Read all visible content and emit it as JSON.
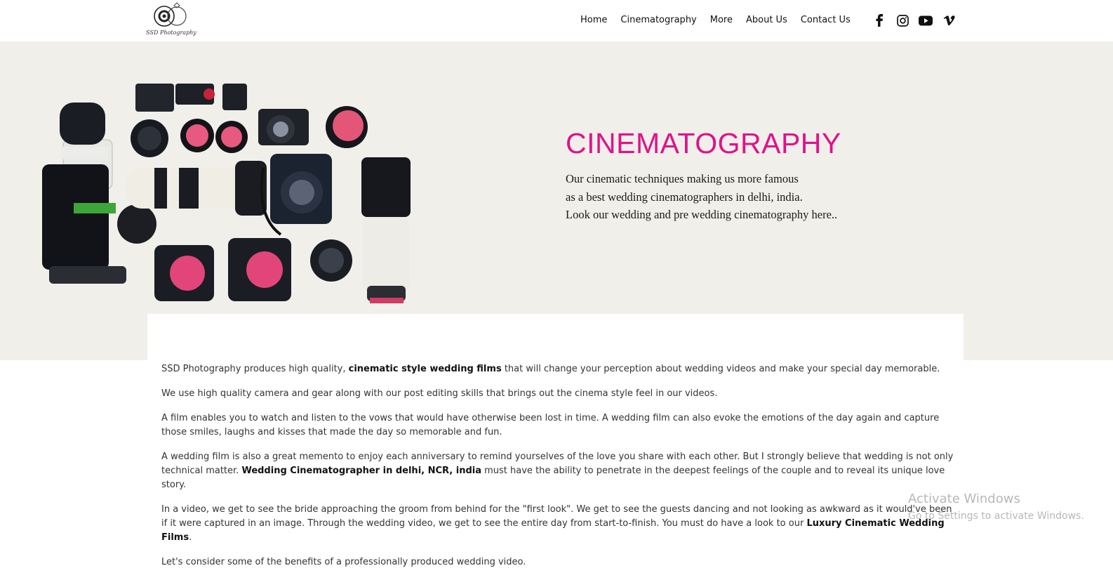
{
  "header": {
    "logo_text": "SSD Photography",
    "nav": [
      "Home",
      "Cinematography",
      "More",
      "About Us",
      "Contact Us"
    ],
    "social_icons": [
      "facebook-icon",
      "instagram-icon",
      "youtube-icon",
      "vimeo-icon"
    ]
  },
  "hero": {
    "title": "CINEMATOGRAPHY",
    "lines": [
      "Our cinematic techniques making us more famous",
      "as a best wedding cinematographers in delhi, india.",
      "Look our wedding and pre wedding cinematography here.."
    ],
    "title_color": "#e0128a",
    "background": "#f1efea"
  },
  "content": {
    "p1_a": "SSD Photography produces high quality, ",
    "p1_b": "cinematic style wedding films",
    "p1_c": " that will change your perception about wedding videos and make your special day memorable.",
    "p2": "We use high quality camera and gear along with our post editing skills that brings out the cinema style feel in our videos.",
    "p3": "A film enables you to watch and listen to the vows that would have otherwise been lost in time. A wedding film can also evoke the emotions of the day again and capture those smiles, laughs and kisses that made the day so memorable and fun.",
    "p4_a": "A wedding film is also a great memento to enjoy each anniversary to remind yourselves of the love you share with each other. But I strongly believe that wedding is not only technical matter. ",
    "p4_b": "Wedding Cinematographer in delhi, NCR, india",
    "p4_c": " must have the ability to penetrate in the deepest feelings of the couple and to reveal its unique love story.",
    "p5_a": "In a video, we get to see the bride approaching the groom from behind for the \"first look\". We get to see the guests dancing and not looking as awkward as it would've been if it were captured in an image. Through the wedding video, we get to see the entire day from start-to-finish. You must do have a look to our ",
    "p5_b": "Luxury Cinematic Wedding Films",
    "p5_c": ".",
    "p6": "Let's consider some of the benefits of a professionally produced wedding video."
  },
  "watermark": {
    "line1": "Activate Windows",
    "line2": "Go to Settings to activate Windows."
  }
}
